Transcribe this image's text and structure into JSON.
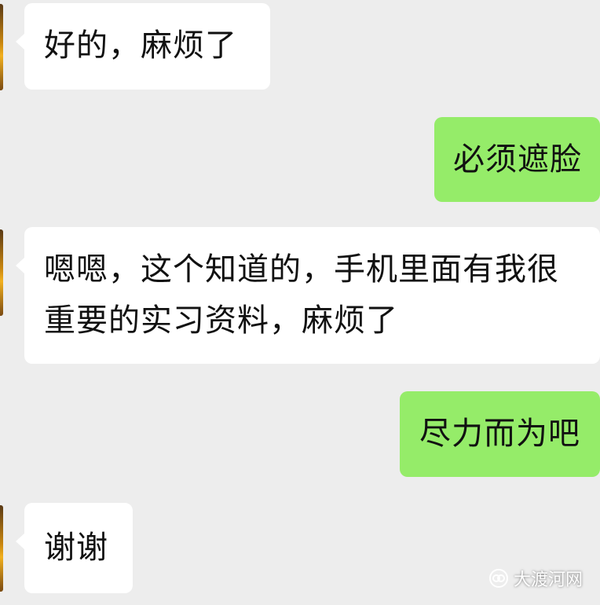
{
  "chat": {
    "messages": [
      {
        "side": "in",
        "text": "好的，麻烦了"
      },
      {
        "side": "out",
        "text": "必须遮脸"
      },
      {
        "side": "in",
        "text": "嗯嗯，这个知道的，手机里面有我很\n重要的实习资料，麻烦了"
      },
      {
        "side": "out",
        "text": "尽力而为吧"
      },
      {
        "side": "in",
        "text": "谢谢"
      }
    ]
  },
  "watermark": {
    "label": "大渡河网",
    "icon": "wechat-official-account-icon"
  },
  "colors": {
    "background": "#ededed",
    "received_bubble": "#ffffff",
    "sent_bubble": "#95ec69",
    "text": "#111111"
  }
}
